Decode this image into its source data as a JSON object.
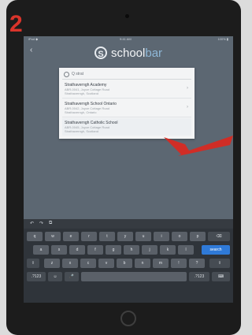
{
  "step_number": "2",
  "status_bar": {
    "carrier": "iPad ◆",
    "time": "9:41 AM",
    "battery": "100% ▮"
  },
  "header": {
    "back_icon": "chevron-left-icon",
    "logo_text_1": "school",
    "logo_text_2": "bar"
  },
  "search": {
    "value": "Q strat"
  },
  "results": [
    {
      "name": "Strathaverngh Academy",
      "line1": "ABR-0041, Joyce Cottage Road",
      "line2": "Strathaverngh, Scotland"
    },
    {
      "name": "Strathaverngh School Ontario",
      "line1": "ABR-0042, Joyce Cottage Road",
      "line2": "Strathaverngh, Ontario"
    },
    {
      "name": "Strathaverngh Catholic School",
      "line1": "ABR-0045, Joyce Cottage Road",
      "line2": "Strathaverngh, Scotland"
    }
  ],
  "keyboard": {
    "toolbar": [
      "↶",
      "↷",
      "⧉"
    ],
    "row1": [
      "q",
      "w",
      "e",
      "r",
      "t",
      "y",
      "u",
      "i",
      "o",
      "p",
      "⌫"
    ],
    "row2": [
      "a",
      "s",
      "d",
      "f",
      "g",
      "h",
      "j",
      "k",
      "l",
      "search"
    ],
    "row3": [
      "⇧",
      "z",
      "x",
      "c",
      "v",
      "b",
      "n",
      "m",
      "!",
      "?",
      "⇧"
    ],
    "row4": [
      ".?123",
      "☺",
      "🎤",
      "",
      ".?123",
      "⌨"
    ]
  },
  "colors": {
    "arrow": "#d62a22",
    "step": "#d9342b",
    "search_key": "#2f7ad8"
  }
}
